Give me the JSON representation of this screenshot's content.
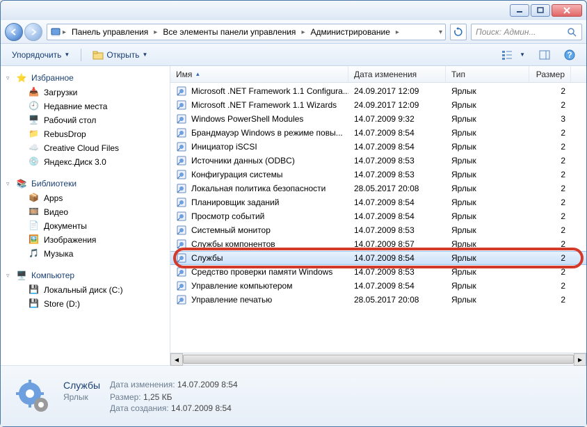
{
  "breadcrumb": [
    "Панель управления",
    "Все элементы панели управления",
    "Администрирование"
  ],
  "search_placeholder": "Поиск: Админ...",
  "toolbar": {
    "organize": "Упорядочить",
    "open": "Открыть"
  },
  "columns": {
    "name": "Имя",
    "date": "Дата изменения",
    "type": "Тип",
    "size": "Размер"
  },
  "tree": {
    "favorites": "Избранное",
    "fav_items": [
      "Загрузки",
      "Недавние места",
      "Рабочий стол",
      "RebusDrop",
      "Creative Cloud Files",
      "Яндекс.Диск 3.0"
    ],
    "libraries": "Библиотеки",
    "lib_items": [
      "Apps",
      "Видео",
      "Документы",
      "Изображения",
      "Музыка"
    ],
    "computer": "Компьютер",
    "comp_items": [
      "Локальный диск (C:)",
      "Store (D:)"
    ]
  },
  "rows": [
    {
      "name": "Microsoft .NET Framework 1.1 Configura...",
      "date": "24.09.2017 12:09",
      "type": "Ярлык",
      "size": "2"
    },
    {
      "name": "Microsoft .NET Framework 1.1 Wizards",
      "date": "24.09.2017 12:09",
      "type": "Ярлык",
      "size": "2"
    },
    {
      "name": "Windows PowerShell Modules",
      "date": "14.07.2009 9:32",
      "type": "Ярлык",
      "size": "3"
    },
    {
      "name": "Брандмауэр Windows в режиме повы...",
      "date": "14.07.2009 8:54",
      "type": "Ярлык",
      "size": "2"
    },
    {
      "name": "Инициатор iSCSI",
      "date": "14.07.2009 8:54",
      "type": "Ярлык",
      "size": "2"
    },
    {
      "name": "Источники данных (ODBC)",
      "date": "14.07.2009 8:53",
      "type": "Ярлык",
      "size": "2"
    },
    {
      "name": "Конфигурация системы",
      "date": "14.07.2009 8:53",
      "type": "Ярлык",
      "size": "2"
    },
    {
      "name": "Локальная политика безопасности",
      "date": "28.05.2017 20:08",
      "type": "Ярлык",
      "size": "2"
    },
    {
      "name": "Планировщик заданий",
      "date": "14.07.2009 8:54",
      "type": "Ярлык",
      "size": "2"
    },
    {
      "name": "Просмотр событий",
      "date": "14.07.2009 8:54",
      "type": "Ярлык",
      "size": "2"
    },
    {
      "name": "Системный монитор",
      "date": "14.07.2009 8:53",
      "type": "Ярлык",
      "size": "2"
    },
    {
      "name": "Службы компонентов",
      "date": "14.07.2009 8:57",
      "type": "Ярлык",
      "size": "2"
    },
    {
      "name": "Службы",
      "date": "14.07.2009 8:54",
      "type": "Ярлык",
      "size": "2",
      "selected": true,
      "highlight": true
    },
    {
      "name": "Средство проверки памяти Windows",
      "date": "14.07.2009 8:53",
      "type": "Ярлык",
      "size": "2"
    },
    {
      "name": "Управление компьютером",
      "date": "14.07.2009 8:54",
      "type": "Ярлык",
      "size": "2"
    },
    {
      "name": "Управление печатью",
      "date": "28.05.2017 20:08",
      "type": "Ярлык",
      "size": "2"
    }
  ],
  "details": {
    "title": "Службы",
    "type": "Ярлык",
    "modified_label": "Дата изменения:",
    "modified": "14.07.2009 8:54",
    "size_label": "Размер:",
    "size": "1,25 КБ",
    "created_label": "Дата создания:",
    "created": "14.07.2009 8:54"
  }
}
